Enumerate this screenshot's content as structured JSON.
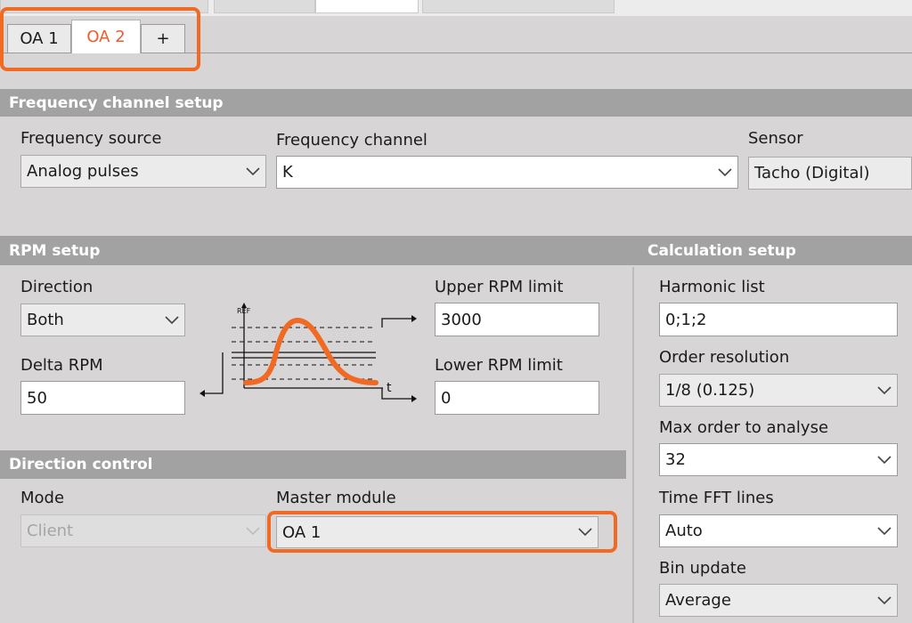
{
  "tabs": [
    {
      "label": "OA 1"
    },
    {
      "label": "OA 2"
    },
    {
      "label": "+"
    }
  ],
  "frequency_setup": {
    "header": "Frequency channel setup",
    "source_label": "Frequency source",
    "source_value": "Analog pulses",
    "channel_label": "Frequency channel",
    "channel_value": "K",
    "sensor_label": "Sensor",
    "sensor_value": "Tacho (Digital)"
  },
  "rpm_setup": {
    "header": "RPM setup",
    "direction_label": "Direction",
    "direction_value": "Both",
    "delta_label": "Delta RPM",
    "delta_value": "50",
    "upper_label": "Upper RPM limit",
    "upper_value": "3000",
    "lower_label": "Lower RPM limit",
    "lower_value": "0",
    "diagram": {
      "ref_label": "REF",
      "t_label": "t",
      "curve_color": "#f06a24"
    }
  },
  "direction_control": {
    "header": "Direction control",
    "mode_label": "Mode",
    "mode_value": "Client",
    "master_label": "Master module",
    "master_value": "OA 1"
  },
  "calculation_setup": {
    "header": "Calculation setup",
    "harmonic_label": "Harmonic list",
    "harmonic_value": "0;1;2",
    "order_res_label": "Order resolution",
    "order_res_value": "1/8 (0.125)",
    "max_order_label": "Max order to analyse",
    "max_order_value": "32",
    "fft_label": "Time FFT lines",
    "fft_value": "Auto",
    "bin_label": "Bin update",
    "bin_value": "Average"
  },
  "colors": {
    "accent": "#f06a24",
    "active_tab_text": "#ef5c2d",
    "header_bg": "#a2a2a2",
    "panel_bg": "#d7d5d6"
  },
  "icons": [
    "chevron-down-icon",
    "rpm-trigger-diagram"
  ]
}
